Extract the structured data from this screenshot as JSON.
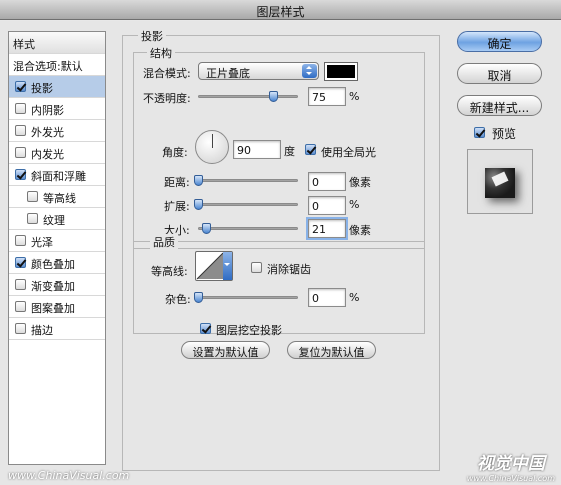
{
  "window": {
    "title": "图层样式"
  },
  "style_list": {
    "header": "样式",
    "blend_options": "混合选项:默认",
    "items": [
      {
        "label": "投影",
        "checked": true,
        "selected": true
      },
      {
        "label": "内阴影",
        "checked": false
      },
      {
        "label": "外发光",
        "checked": false
      },
      {
        "label": "内发光",
        "checked": false
      },
      {
        "label": "斜面和浮雕",
        "checked": true
      },
      {
        "label": "等高线",
        "checked": false,
        "indent": true
      },
      {
        "label": "纹理",
        "checked": false,
        "indent": true
      },
      {
        "label": "光泽",
        "checked": false
      },
      {
        "label": "颜色叠加",
        "checked": true
      },
      {
        "label": "渐变叠加",
        "checked": false
      },
      {
        "label": "图案叠加",
        "checked": false
      },
      {
        "label": "描边",
        "checked": false
      }
    ]
  },
  "drop_shadow": {
    "section_title": "投影",
    "structure": {
      "title": "结构",
      "blend_mode_label": "混合模式:",
      "blend_mode_value": "正片叠底",
      "shadow_color": "#000000",
      "opacity_label": "不透明度:",
      "opacity_value": "75",
      "opacity_unit": "%",
      "opacity_percent": 75,
      "angle_label": "角度:",
      "angle_value": "90",
      "angle_unit": "度",
      "use_global_light_label": "使用全局光",
      "use_global_light": true,
      "distance_label": "距离:",
      "distance_value": "0",
      "distance_unit": "像素",
      "spread_label": "扩展:",
      "spread_value": "0",
      "spread_unit": "%",
      "size_label": "大小:",
      "size_value": "21",
      "size_unit": "像素",
      "size_fraction": 0.084
    },
    "quality": {
      "title": "品质",
      "contour_label": "等高线:",
      "anti_aliased_label": "消除锯齿",
      "anti_aliased": false,
      "noise_label": "杂色:",
      "noise_value": "0",
      "noise_unit": "%"
    },
    "layer_knocks_out_label": "图层挖空投影",
    "layer_knocks_out": true,
    "make_default_label": "设置为默认值",
    "reset_default_label": "复位为默认值"
  },
  "buttons": {
    "ok": "确定",
    "cancel": "取消",
    "new_style": "新建样式...",
    "preview_label": "预览",
    "preview_checked": true
  },
  "watermarks": {
    "left": "www.ChinaVisual.com",
    "right_title": "视觉中国",
    "right_url": "www.ChinaVisual.com"
  }
}
